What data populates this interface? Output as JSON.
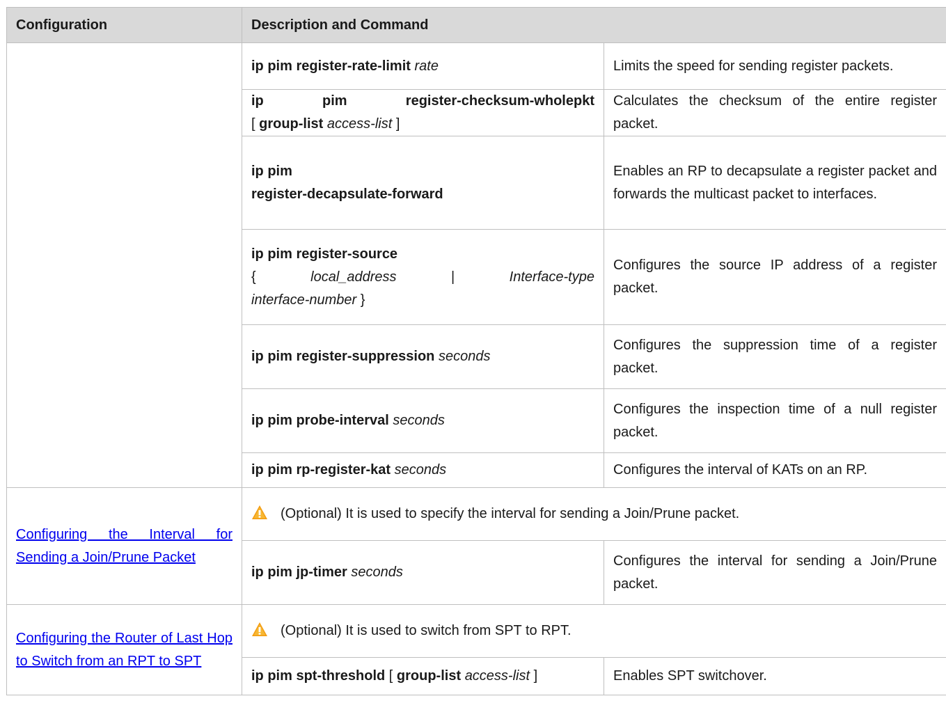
{
  "header": {
    "col_config": "Configuration",
    "col_desc": "Description and Command"
  },
  "rows": [
    {
      "cmd_kw": "ip pim register-rate-limit",
      "cmd_arg": "rate",
      "desc": "Limits the speed for sending register packets."
    },
    {
      "cmd_kw1": "ip",
      "cmd_kw2": "pim",
      "cmd_kw3": "register-checksum-wholepkt",
      "bracket_open": "[",
      "cmd_kw4": "group-list",
      "cmd_arg": "access-list",
      "bracket_close": "]",
      "desc": "Calculates the checksum of the entire register packet."
    },
    {
      "cmd_line1": "ip pim",
      "cmd_line2": "register-decapsulate-forward",
      "desc": "Enables an RP to decapsulate a register packet and forwards the multicast packet to interfaces."
    },
    {
      "cmd_line1": "ip pim register-source",
      "brace_open": "{",
      "arg1": "local_address",
      "pipe": "|",
      "arg2": "Interface-type",
      "arg3": "interface-number",
      "brace_close": "}",
      "desc": "Configures the source IP address of a register packet."
    },
    {
      "cmd_kw": "ip pim register-suppression",
      "cmd_arg": "seconds",
      "desc": "Configures the suppression time of a register packet."
    },
    {
      "cmd_kw": "ip pim probe-interval",
      "cmd_arg": "seconds",
      "desc": "Configures the inspection time of a null register packet."
    },
    {
      "cmd_kw": "ip pim rp-register-kat",
      "cmd_arg": "seconds",
      "desc": "Configures the interval of KATs on an RP."
    }
  ],
  "section_jp": {
    "link": "Configuring the Interval for Sending a Join/Prune Packet",
    "note": "(Optional) It is used to specify the interval for sending a Join/Prune packet.",
    "cmd_kw": "ip pim jp-timer",
    "cmd_arg": "seconds",
    "desc": "Configures the interval for sending a Join/Prune packet."
  },
  "section_spt": {
    "link": "Configuring the Router of Last Hop to Switch from an RPT to SPT",
    "note": "(Optional) It is used to switch from SPT to RPT.",
    "cmd_kw": "ip pim spt-threshold",
    "bracket_open": "[",
    "cmd_kw2": "group-list",
    "cmd_arg": "access-list",
    "bracket_close": "]",
    "desc": "Enables SPT switchover."
  },
  "icons": {
    "warning": "warning-icon",
    "warning_color": "#f39c12"
  }
}
